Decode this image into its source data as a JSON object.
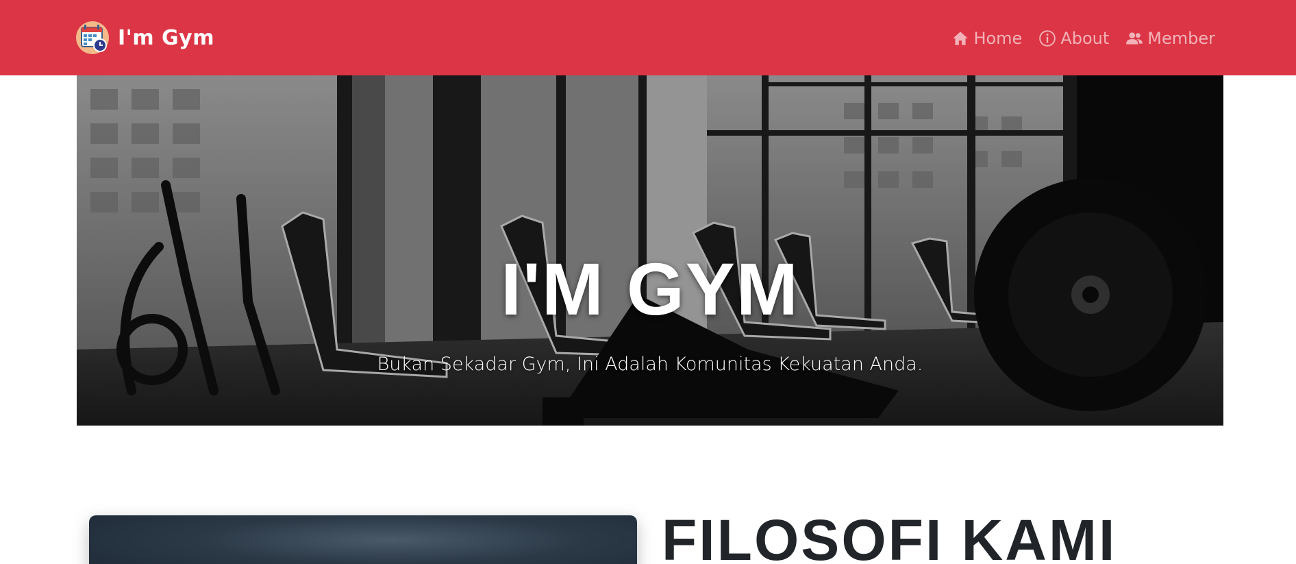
{
  "navbar": {
    "brand_text": "I'm Gym",
    "brand_logo": "calendar-clock-icon",
    "background_color": "#dc3545",
    "links": [
      {
        "label": "Home",
        "icon": "house-icon"
      },
      {
        "label": "About",
        "icon": "info-circle-icon"
      },
      {
        "label": "Member",
        "icon": "people-icon"
      }
    ]
  },
  "hero": {
    "title": "I'M GYM",
    "subtitle": "Bukan Sekadar Gym, Ini Adalah Komunitas Kekuatan Anda.",
    "background_image": "gym-interior-grayscale"
  },
  "philosophy": {
    "title": "FILOSOFI KAMI",
    "image": "dusk-silhouette-photo"
  }
}
